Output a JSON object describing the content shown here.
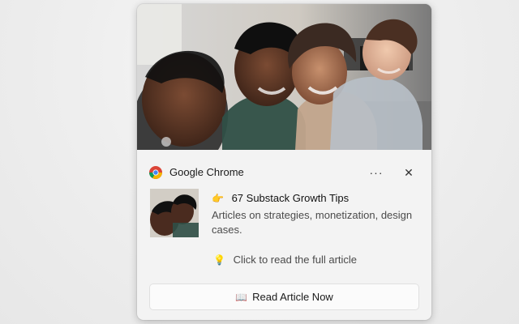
{
  "notification": {
    "app_name": "Google Chrome",
    "more_glyph": "···",
    "close_glyph": "✕",
    "title_emoji": "👉",
    "title": "67 Substack Growth Tips",
    "description": "Articles on strategies, monetization, design cases.",
    "hint_emoji": "💡",
    "hint": "Click to read the full article",
    "action": {
      "emoji": "📖",
      "label": "Read Article Now"
    }
  },
  "icons": {
    "app_logo": "chrome-logo-icon",
    "more": "more-options-icon",
    "close": "close-icon"
  },
  "colors": {
    "chrome_red": "#DB4437",
    "chrome_yellow": "#F4B400",
    "chrome_green": "#0F9D58",
    "chrome_blue": "#4285F4"
  }
}
